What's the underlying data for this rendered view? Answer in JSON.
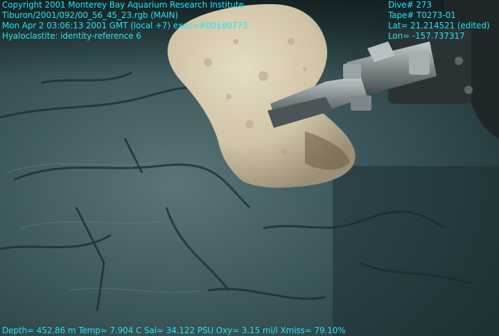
{
  "overlay": {
    "text_color": "#22e6f2",
    "top_left": [
      "Copyright 2001 Monterey Bay Aquarium Research Institute",
      "Tiburon/2001/092/00_56_45_23.rgb (MAIN)",
      "Mon Apr  2 03:06:13 2001 GMT (local +7)  exec=#00180773",
      "Hyaloclastite: identity-reference 6"
    ],
    "top_right": [
      "Dive# 273",
      "Tape# T0273-01",
      "Lat= 21.214521 (edited)",
      "Lon= -157.737317"
    ],
    "bottom": "Depth= 452.86 m  Temp= 7.904 C  Sal= 34.122 PSU  Oxy= 3.15 ml/l  Xmiss= 79.10%"
  },
  "scene": {
    "seafloor_color": "#2e4a4f",
    "rock_color": "#d8cfb4",
    "claw_color": "#8a9498"
  }
}
